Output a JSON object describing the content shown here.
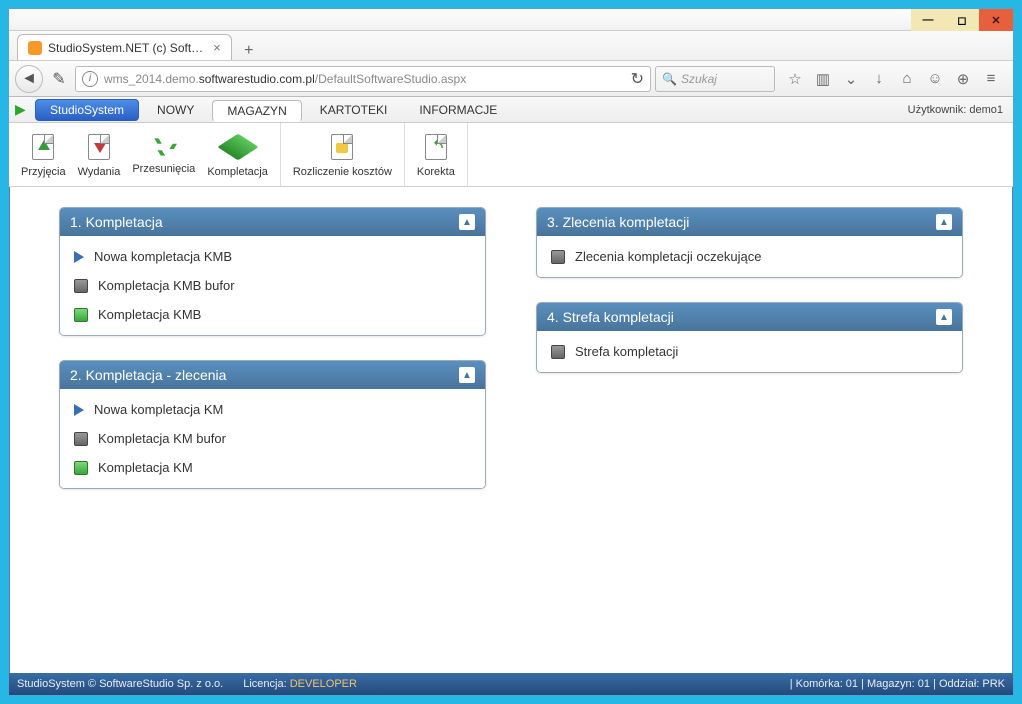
{
  "window": {
    "tab_title": "StudioSystem.NET (c) Soft…"
  },
  "nav": {
    "url_prefix": "wms_2014.demo.",
    "url_bold": "softwarestudio.com.pl",
    "url_suffix": "/DefaultSoftwareStudio.aspx",
    "search_placeholder": "Szukaj"
  },
  "menu": {
    "brand": "StudioSystem",
    "items": [
      "NOWY",
      "MAGAZYN",
      "KARTOTEKI",
      "INFORMACJE"
    ],
    "user_label": "Użytkownik: demo1"
  },
  "ribbon": {
    "group1": [
      {
        "label": "Przyjęcia",
        "icon": "arrow-up"
      },
      {
        "label": "Wydania",
        "icon": "arrow-down"
      },
      {
        "label": "Przesunięcia",
        "icon": "recycle"
      },
      {
        "label": "Kompletacja",
        "icon": "cube"
      }
    ],
    "group2": [
      {
        "label": "Rozliczenie kosztów",
        "icon": "doc-yellow"
      }
    ],
    "group3": [
      {
        "label": "Korekta",
        "icon": "recycle-doc"
      }
    ]
  },
  "panels": {
    "left": [
      {
        "title": "1. Kompletacja",
        "items": [
          {
            "icon": "play-blue",
            "label": "Nowa kompletacja KMB"
          },
          {
            "icon": "square-gray",
            "label": "Kompletacja KMB bufor"
          },
          {
            "icon": "square-green",
            "label": "Kompletacja KMB"
          }
        ]
      },
      {
        "title": "2. Kompletacja - zlecenia",
        "items": [
          {
            "icon": "play-blue",
            "label": "Nowa kompletacja KM"
          },
          {
            "icon": "square-gray",
            "label": "Kompletacja KM bufor"
          },
          {
            "icon": "square-green",
            "label": "Kompletacja KM"
          }
        ]
      }
    ],
    "right": [
      {
        "title": "3. Zlecenia kompletacji",
        "items": [
          {
            "icon": "square-gray",
            "label": "Zlecenia kompletacji oczekujące"
          }
        ]
      },
      {
        "title": "4. Strefa kompletacji",
        "items": [
          {
            "icon": "square-gray",
            "label": "Strefa kompletacji"
          }
        ]
      }
    ]
  },
  "status": {
    "left": "StudioSystem © SoftwareStudio Sp. z o.o.",
    "license_label": "Licencja: ",
    "license_value": "DEVELOPER",
    "right": "| Komórka: 01 | Magazyn: 01 | Oddział: PRK"
  }
}
